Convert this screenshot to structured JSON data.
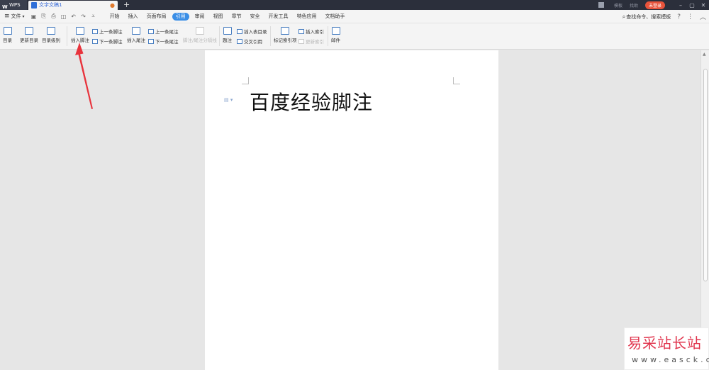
{
  "titlebar": {
    "app_tab": "WPS",
    "doc_tab": "文字文稿1",
    "close_glyph": "●",
    "add_tab": "+",
    "right_items": [
      "模板",
      "找助"
    ],
    "login": "未登录",
    "win_min": "–",
    "win_restore": "▢",
    "win_close": "✕"
  },
  "menubar": {
    "file": "文件",
    "file_caret": "▾",
    "items": [
      "开始",
      "插入",
      "页面布局",
      "引用",
      "审阅",
      "视图",
      "章节",
      "安全",
      "开发工具",
      "特色应用",
      "文档助手"
    ],
    "active_index": 3,
    "search": "查找命令、搜索模板",
    "help": "?",
    "more": "⋮",
    "collapse": "︿"
  },
  "ribbon": {
    "toc": "目录",
    "update_toc": "更新目录",
    "toc_level": "目录级别",
    "insert_footnote": "插入脚注",
    "prev_footnote": "上一条脚注",
    "next_footnote": "下一条脚注",
    "insert_endnote": "插入尾注",
    "prev_endnote": "上一条尾注",
    "next_endnote": "下一条尾注",
    "footnote_separator": "脚注/尾注分隔线",
    "caption": "题注",
    "insert_table_of_figures": "插入表目录",
    "cross_reference": "交叉引用",
    "mark_index_entry": "标记索引项",
    "insert_index": "插入索引",
    "update_index": "更新索引",
    "mail": "邮件"
  },
  "document": {
    "heading": "百度经验脚注",
    "para_mark": "▤ ▾"
  },
  "watermark": {
    "cn": "易采站长站",
    "en": "www.easck.com"
  },
  "colors": {
    "accent": "#3a8ee6",
    "titlebar": "#2b2f3b",
    "login": "#e8533b",
    "arrow": "#e8333c"
  }
}
